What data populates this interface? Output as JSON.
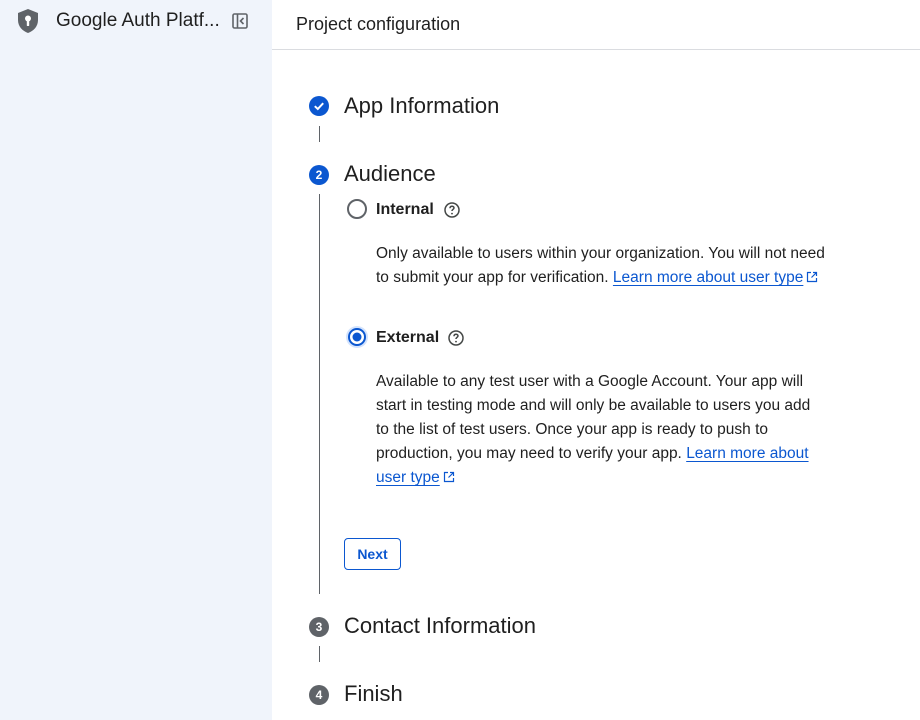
{
  "sidebar": {
    "title": "Google Auth Platf...",
    "icons": {
      "brand": "shield-keyhole-icon",
      "collapse": "collapse-sidebar-icon"
    }
  },
  "header": {
    "title": "Project configuration"
  },
  "steps": [
    {
      "marker": "",
      "title": "App Information",
      "state": "done"
    },
    {
      "marker": "2",
      "title": "Audience",
      "state": "active"
    },
    {
      "marker": "3",
      "title": "Contact Information",
      "state": "pending"
    },
    {
      "marker": "4",
      "title": "Finish",
      "state": "pending"
    }
  ],
  "audience": {
    "internal": {
      "label": "Internal",
      "selected": false,
      "desc": "Only available to users within your organization. You will not need to submit your app for verification. ",
      "link": "Learn more about user type"
    },
    "external": {
      "label": "External",
      "selected": true,
      "desc": "Available to any test user with a Google Account. Your app will start in testing mode and will only be available to users you add to the list of test users. Once your app is ready to push to production, you may need to verify your app. ",
      "link": "Learn more about user type"
    },
    "next_label": "Next"
  },
  "colors": {
    "accent": "#0b57d0",
    "sidebar_bg": "#f0f4fb",
    "pending": "#5f6368"
  }
}
